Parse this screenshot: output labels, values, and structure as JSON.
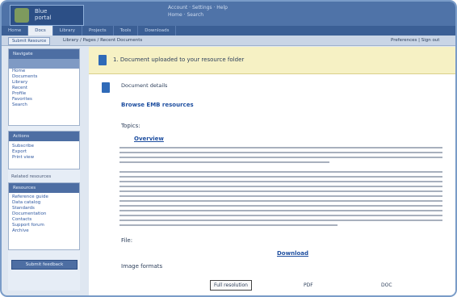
{
  "header": {
    "logo_text": "Blue\nportal",
    "nav_line1": "Account · Settings · Help",
    "nav_line2": "Home · Search"
  },
  "tabs": [
    "Home",
    "Docs",
    "Library",
    "Projects",
    "Tools",
    "Downloads"
  ],
  "active_tab": 1,
  "toolbar": {
    "button_label": "Submit Resource",
    "path_text": "Library / Pages / Recent Documents",
    "right_text": "Preferences  |  Sign out"
  },
  "sidebar": {
    "box1": {
      "header": "Navigate",
      "items": [
        "Home",
        "Documents",
        "Library",
        "Recent",
        "Profile",
        "Favorites",
        "Search"
      ]
    },
    "box2": {
      "header": "Actions",
      "items": [
        "Subscribe",
        "Export",
        "Print view"
      ]
    },
    "section_label": "Related resources",
    "box3": {
      "header": "Resources",
      "items": [
        "Reference guide",
        "Data catalog",
        "Standards",
        "Documentation",
        "Contacts",
        "Support forum",
        "Archive"
      ]
    },
    "bottom_button": "Submit feedback"
  },
  "content": {
    "banner_text": "1. Document uploaded to your resource folder",
    "heading": "Document details",
    "link_title": "Browse EMB resources",
    "topics_label": "Topics:",
    "overview_link": "Overview",
    "file_label": "File:",
    "download_link": "Download",
    "images_label": "Image formats",
    "image_tabs": [
      "Full resolution",
      "PDF",
      "DOC"
    ]
  }
}
